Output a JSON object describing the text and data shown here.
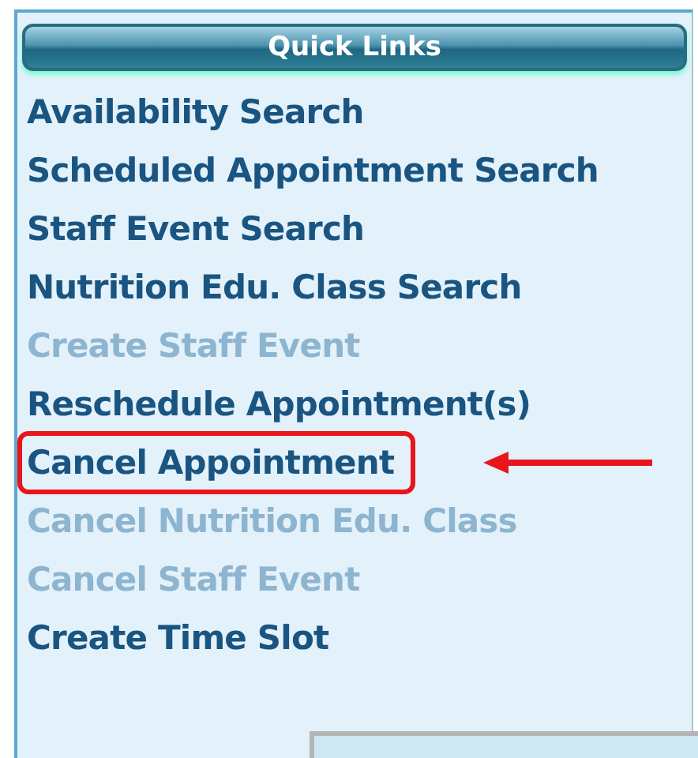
{
  "panel": {
    "title": "Quick Links"
  },
  "links": [
    {
      "label": "Availability Search",
      "disabled": false,
      "highlighted": false
    },
    {
      "label": "Scheduled Appointment Search",
      "disabled": false,
      "highlighted": false
    },
    {
      "label": "Staff Event Search",
      "disabled": false,
      "highlighted": false
    },
    {
      "label": "Nutrition Edu. Class Search",
      "disabled": false,
      "highlighted": false
    },
    {
      "label": "Create Staff Event",
      "disabled": true,
      "highlighted": false
    },
    {
      "label": "Reschedule Appointment(s)",
      "disabled": false,
      "highlighted": false
    },
    {
      "label": "Cancel Appointment",
      "disabled": false,
      "highlighted": true
    },
    {
      "label": "Cancel Nutrition Edu. Class",
      "disabled": true,
      "highlighted": false
    },
    {
      "label": "Cancel Staff Event",
      "disabled": true,
      "highlighted": false
    },
    {
      "label": "Create Time Slot",
      "disabled": false,
      "highlighted": false
    }
  ]
}
